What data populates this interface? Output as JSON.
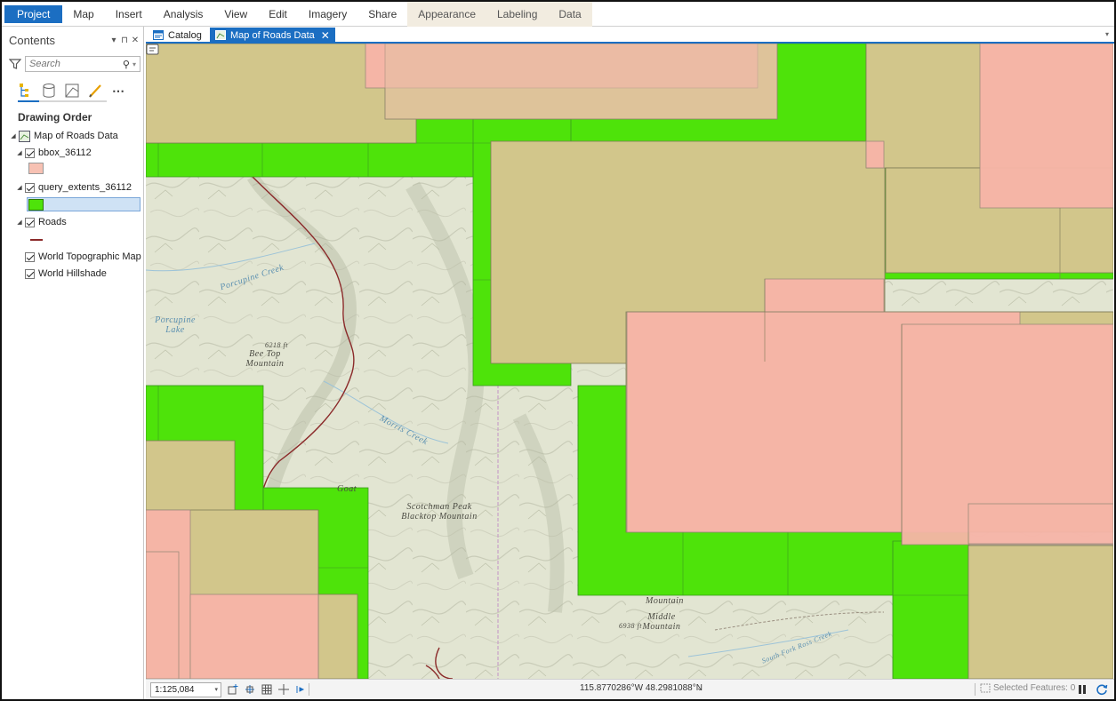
{
  "ribbon": {
    "tabs": [
      {
        "label": "Project",
        "active": true
      },
      {
        "label": "Map"
      },
      {
        "label": "Insert"
      },
      {
        "label": "Analysis"
      },
      {
        "label": "View"
      },
      {
        "label": "Edit"
      },
      {
        "label": "Imagery"
      },
      {
        "label": "Share"
      },
      {
        "label": "Appearance",
        "contextual": true
      },
      {
        "label": "Labeling",
        "contextual": true
      },
      {
        "label": "Data",
        "contextual": true
      }
    ]
  },
  "contents": {
    "title": "Contents",
    "search_placeholder": "Search",
    "drawing_order": "Drawing Order",
    "map_name": "Map of Roads Data",
    "layers": [
      {
        "name": "bbox_36112",
        "checked": true,
        "swatch": "#f7c1b3"
      },
      {
        "name": "query_extents_36112",
        "checked": true,
        "swatch": "#4ee30a",
        "selected": true
      },
      {
        "name": "Roads",
        "checked": true,
        "line": "#8b2a2a"
      },
      {
        "name": "World Topographic Map",
        "checked": true
      },
      {
        "name": "World Hillshade",
        "checked": true
      }
    ]
  },
  "doc_tabs": {
    "catalog": "Catalog",
    "map": "Map of Roads Data"
  },
  "map": {
    "labels": {
      "porcupine_creek": "Porcupine Creek",
      "porcupine_lake": "Porcupine Lake",
      "elev_6218": "6218 ft",
      "bee_top": "Bee Top Mountain",
      "morris_creek": "Morris Creek",
      "goat": "Goat",
      "scotchman": "Scotchman Peak Blacktop Mountain",
      "mountain": "Mountain",
      "middle_mountain": "Middle Mountain",
      "elev_6938": "6938 ft",
      "south_fork": "South Fork Ross Creek"
    },
    "colors": {
      "query_extent": "#4ee30a",
      "bbox": "#f7b5a8",
      "overlap": "#d0c48c"
    }
  },
  "status": {
    "scale": "1:125,084",
    "coordinates": "115.8770286°W 48.2981088°N",
    "selected_features": "Selected Features: 0"
  }
}
